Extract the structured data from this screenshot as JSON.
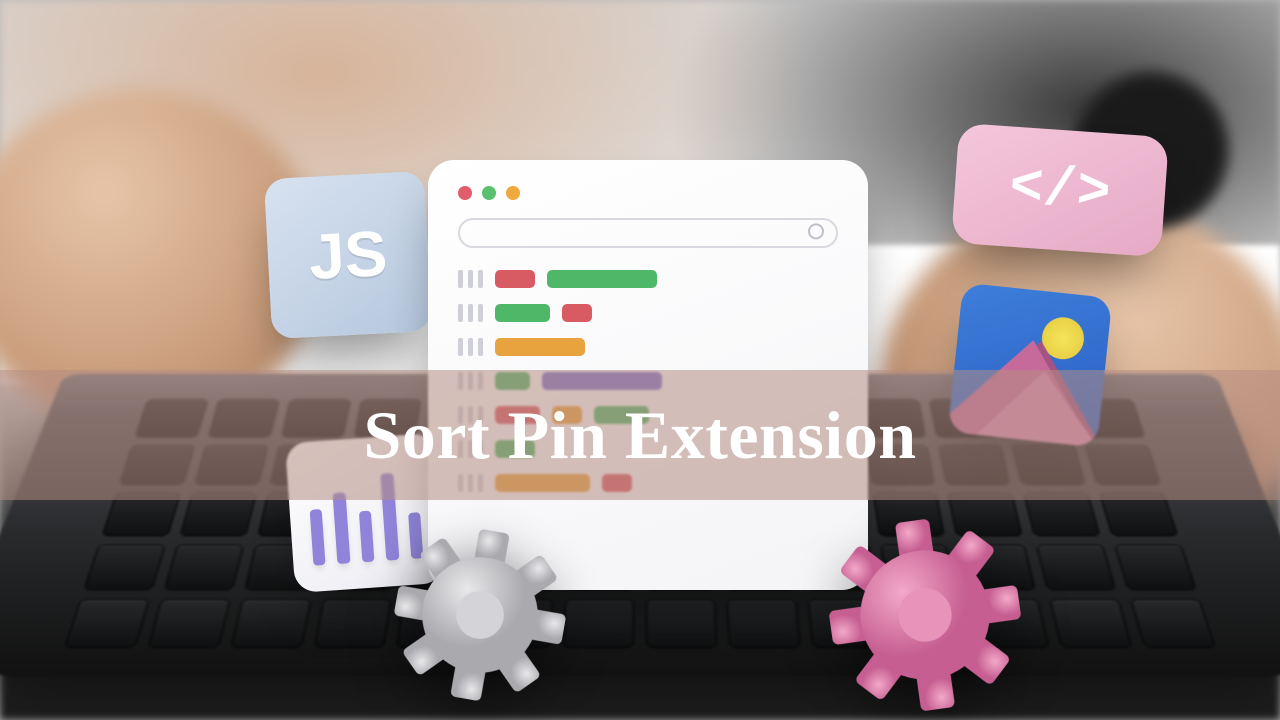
{
  "banner": {
    "title": "Sort Pin Extension"
  },
  "cards": {
    "js_label": "JS",
    "code_label": "</>"
  }
}
